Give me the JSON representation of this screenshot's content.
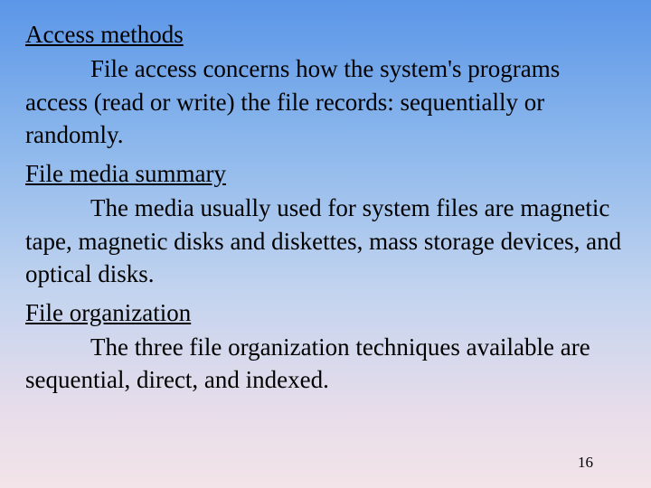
{
  "sections": [
    {
      "heading": "Access methods",
      "body": "File access concerns how the system's programs access (read or write) the file records: sequentially or randomly."
    },
    {
      "heading": "File media summary",
      "body": "The media usually used for system files are magnetic tape, magnetic disks and diskettes, mass storage devices, and optical disks."
    },
    {
      "heading": "File organization",
      "body": "The three file organization techniques available are sequential, direct, and indexed."
    }
  ],
  "page_number": "16"
}
